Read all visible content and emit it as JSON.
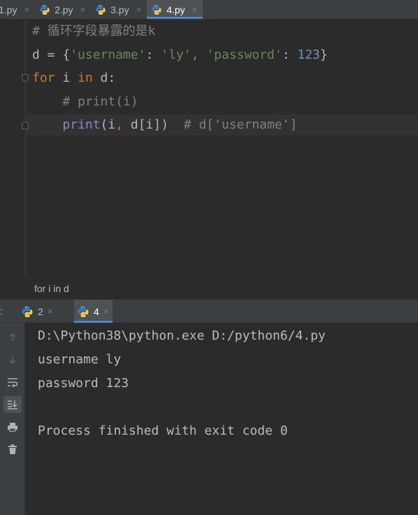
{
  "editor_tabs": [
    {
      "label": "1.py",
      "active": false
    },
    {
      "label": "2.py",
      "active": false
    },
    {
      "label": "3.py",
      "active": false
    },
    {
      "label": "4.py",
      "active": true
    }
  ],
  "tab_close_glyph": "×",
  "code": {
    "line1_comment": "# 循环字段暴露的是k",
    "line2": {
      "var": "d",
      "eq": " = {",
      "key1": "'username'",
      "colon1": ": ",
      "val1": "'ly'",
      "comma1": ", ",
      "key2": "'password'",
      "colon2": ": ",
      "val2": "123",
      "close": "}"
    },
    "line3": {
      "kw_for": "for",
      "mid": " i ",
      "kw_in": "in",
      "rest": " d:"
    },
    "line4_comment": "    # print(i)",
    "line5": {
      "indent": "    ",
      "fn": "print",
      "args_open": "(i",
      "comma": ",",
      "args_rest": " d[i])",
      "gap": "  ",
      "comment": "# d['username']"
    }
  },
  "breadcrumb": "for i in d",
  "run_tabs": {
    "prefix": ":",
    "items": [
      {
        "label": "2",
        "active": false
      },
      {
        "label": "4",
        "active": true
      }
    ]
  },
  "console": {
    "lines": [
      "D:\\Python38\\python.exe D:/python6/4.py",
      "username ly",
      "password 123",
      "",
      "Process finished with exit code 0"
    ]
  },
  "toolbar_icons": [
    "up-arrow-icon",
    "down-arrow-icon",
    "soft-wrap-icon",
    "scroll-to-end-icon",
    "print-icon",
    "trash-icon"
  ],
  "colors": {
    "background": "#2b2b2b",
    "tab_accent": "#4a88c7",
    "keyword": "#cc7832",
    "string": "#6a8759",
    "number": "#6897bb",
    "comment": "#808080",
    "builtin": "#8888c6"
  }
}
